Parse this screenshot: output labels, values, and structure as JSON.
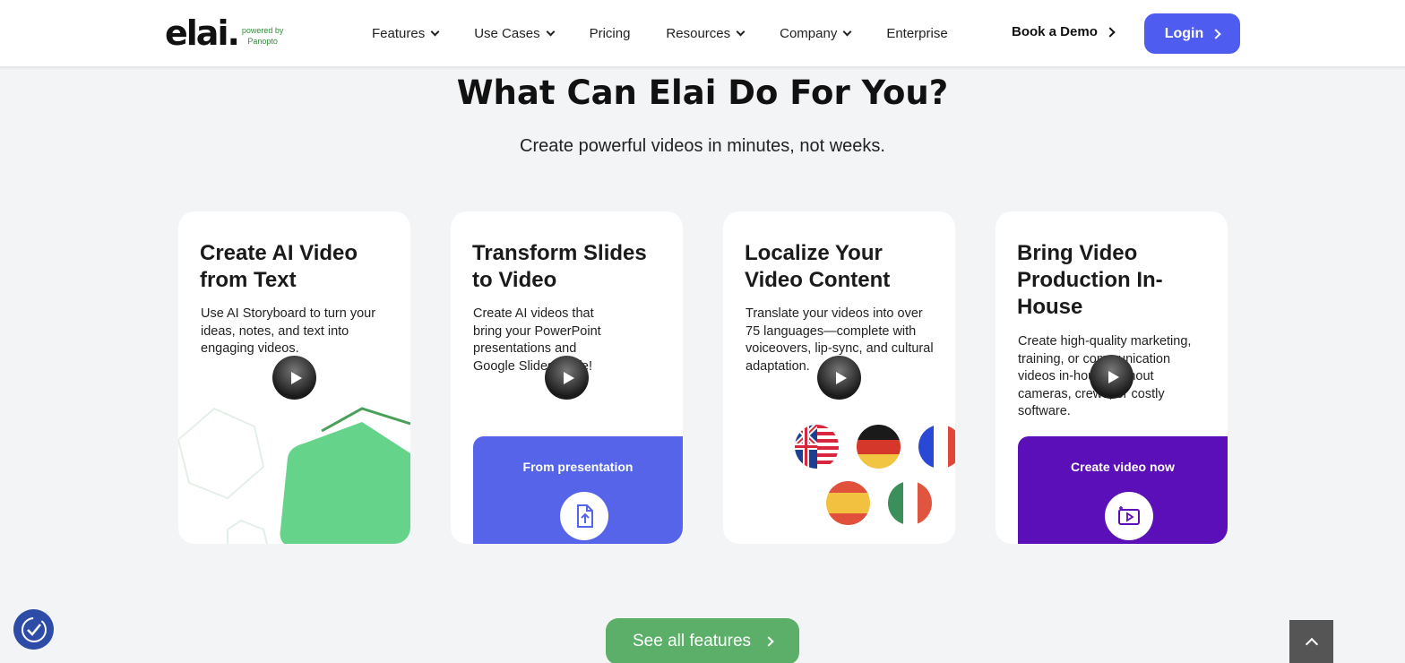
{
  "header": {
    "logo_text": "elai.",
    "logo_sub_line1": "powered by",
    "logo_sub_line2": "Panopto",
    "nav": [
      {
        "label": "Features",
        "dropdown": true
      },
      {
        "label": "Use Cases",
        "dropdown": true
      },
      {
        "label": "Pricing",
        "dropdown": false
      },
      {
        "label": "Resources",
        "dropdown": true
      },
      {
        "label": "Company",
        "dropdown": true
      },
      {
        "label": "Enterprise",
        "dropdown": false
      }
    ],
    "book_demo": "Book a Demo",
    "login": "Login"
  },
  "main": {
    "headline": "What Can Elai Do For You?",
    "subhead": "Create powerful videos in minutes, not weeks.",
    "cards": [
      {
        "title": "Create AI Video from Text",
        "description": "Use AI Storyboard to turn your ideas, notes, and text into engaging videos."
      },
      {
        "title": "Transform Slides to Video",
        "description": "Create AI videos that bring your PowerPoint presentations and Google Slides to life!",
        "panel_label": "From presentation",
        "panel_color": "#5564e8"
      },
      {
        "title": "Localize Your Video Content",
        "description": "Translate your videos into over 75 languages—complete with voiceovers, lip-sync, and cultural adaptation."
      },
      {
        "title": "Bring Video Production In-House",
        "description": "Create high-quality marketing, training, or communication videos in-house without cameras, crews, or costly software.",
        "panel_label": "Create video now",
        "panel_color": "#5a0fb8"
      }
    ],
    "see_all": "See all features"
  },
  "colors": {
    "brand_blue": "#4f5cf0",
    "brand_green": "#5caf69",
    "shape_green": "#66d38a"
  }
}
